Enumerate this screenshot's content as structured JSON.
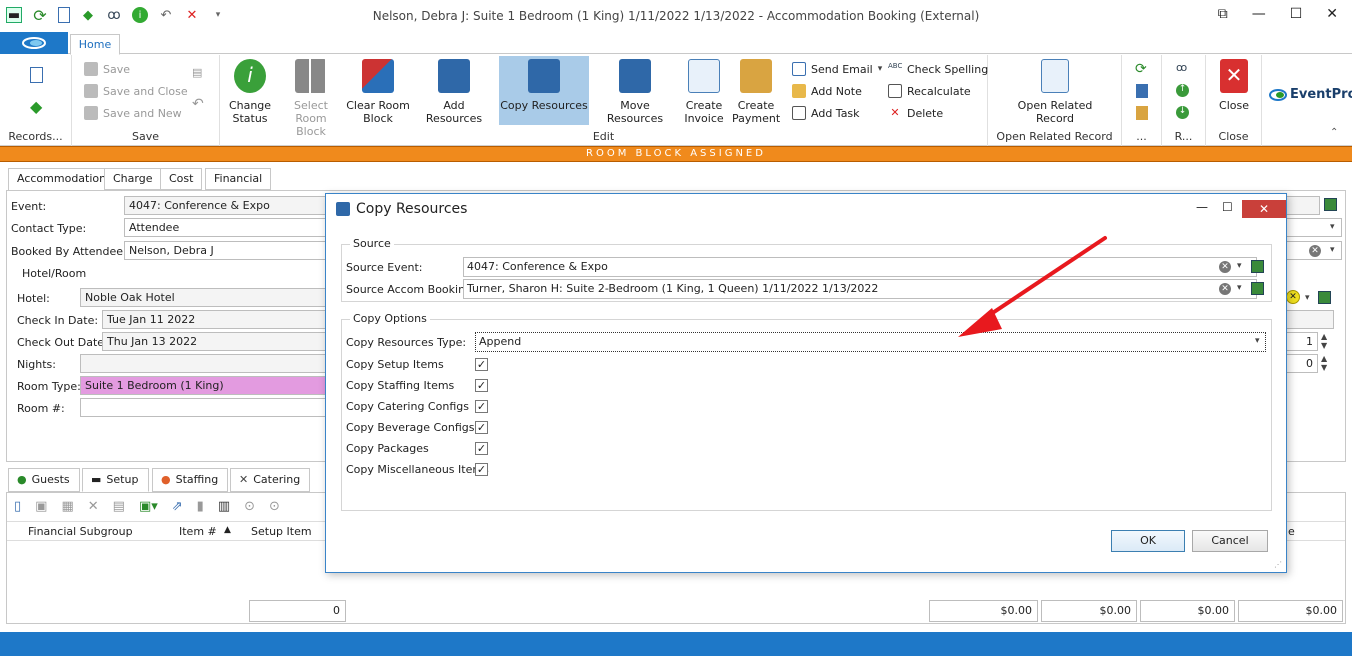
{
  "window": {
    "title": "Nelson, Debra J: Suite 1 Bedroom (1 King) 1/11/2022 1/13/2022 - Accommodation Booking (External)"
  },
  "ribbon": {
    "home_tab": "Home",
    "groups": {
      "records": "Records...",
      "save": "Save",
      "edit": "Edit",
      "open_related": "Open Related Record",
      "dots": "...",
      "r": "R...",
      "close": "Close"
    },
    "save": "Save",
    "save_and_close": "Save and Close",
    "save_and_new": "Save and New",
    "change_status": "Change Status",
    "select_room_block": "Select Room Block",
    "clear_room_block": "Clear Room Block",
    "add_resources": "Add Resources",
    "copy_resources": "Copy Resources",
    "move_resources": "Move Resources",
    "create_invoice": "Create Invoice",
    "create_payment": "Create Payment",
    "send_email": "Send Email",
    "add_note": "Add Note",
    "add_task": "Add Task",
    "check_spelling": "Check Spelling",
    "recalculate": "Recalculate",
    "delete": "Delete",
    "open_related_record": "Open Related Record",
    "close_btn": "Close",
    "logo": "EventPro"
  },
  "banner": "ROOM BLOCK ASSIGNED",
  "form": {
    "tabs": [
      "Accommodation",
      "Charge",
      "Cost",
      "Financial"
    ],
    "event_label": "Event:",
    "event_value": "4047: Conference & Expo",
    "contact_type_label": "Contact Type:",
    "contact_type_value": "Attendee",
    "booked_by_label": "Booked By Attendee:*",
    "booked_by_value": "Nelson, Debra J",
    "hotel_room_group": "Hotel/Room",
    "hotel_label": "Hotel:",
    "hotel_value": "Noble Oak Hotel",
    "checkin_label": "Check In Date:",
    "checkin_value": "Tue Jan 11 2022",
    "checkout_label": "Check Out Date:",
    "checkout_value": "Thu Jan 13 2022",
    "nights_label": "Nights:",
    "room_type_label": "Room Type:",
    "room_type_value": "Suite 1 Bedroom (1 King)",
    "room_num_label": "Room #:",
    "spin1": "1",
    "spin2": "0"
  },
  "bottom": {
    "tabs": [
      "Guests",
      "Setup",
      "Staffing",
      "Catering"
    ],
    "columns": [
      "Financial Subgroup",
      "Item #",
      "Setup Item"
    ],
    "col_tail": "e",
    "totals": [
      "0",
      "$0.00",
      "$0.00",
      "$0.00",
      "$0.00"
    ]
  },
  "dialog": {
    "title": "Copy Resources",
    "source_group": "Source",
    "source_event_label": "Source Event:",
    "source_event_value": "4047: Conference & Expo",
    "source_booking_label": "Source Accom Booking:",
    "source_booking_value": "Turner, Sharon H: Suite 2-Bedroom (1 King, 1 Queen) 1/11/2022 1/13/2022",
    "copy_options_group": "Copy Options",
    "type_label": "Copy Resources Type:",
    "type_value": "Append",
    "options": [
      {
        "label": "Copy Setup Items",
        "checked": true
      },
      {
        "label": "Copy Staffing Items",
        "checked": true
      },
      {
        "label": "Copy Catering Configs",
        "checked": true
      },
      {
        "label": "Copy Beverage Configs",
        "checked": true
      },
      {
        "label": "Copy Packages",
        "checked": true
      },
      {
        "label": "Copy Miscellaneous Items",
        "checked": true
      }
    ],
    "ok": "OK",
    "cancel": "Cancel"
  }
}
